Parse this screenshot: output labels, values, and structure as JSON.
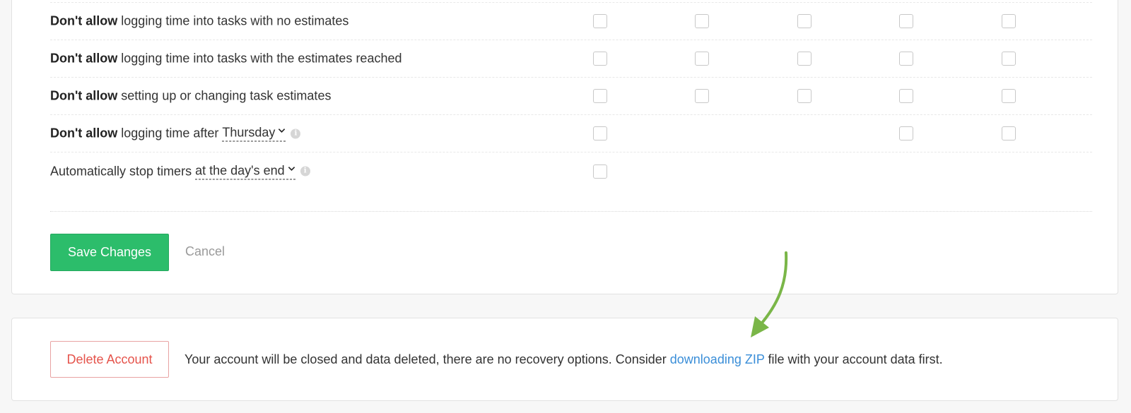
{
  "settings": {
    "rows": [
      {
        "bold": "Don't allow",
        "text": "logging time into tasks with no estimates"
      },
      {
        "bold": "Don't allow",
        "text": "logging time into tasks with the estimates reached"
      },
      {
        "bold": "Don't allow",
        "text": "setting up or changing task estimates"
      },
      {
        "bold": "Don't allow",
        "text": "logging time after",
        "select": "Thursday"
      },
      {
        "text": "Automatically stop timers",
        "select": "at the day's end"
      }
    ],
    "checkbox_states": "all-unchecked",
    "save_label": "Save Changes",
    "cancel_label": "Cancel"
  },
  "delete_account": {
    "button_label": "Delete Account",
    "message_before": "Your account will be closed and data deleted, there are no recovery options. Consider ",
    "link_text": "downloading ZIP",
    "message_after": " file with your account data first."
  },
  "colors": {
    "save_green": "#2cbd6b",
    "delete_red": "#e5534b",
    "link_blue": "#3a8ed8",
    "annotation_arrow": "#7ab648"
  },
  "icons": {
    "dropdown": "chevron-down-icon",
    "info": "info-icon",
    "annotation": "curved-arrow-icon"
  }
}
